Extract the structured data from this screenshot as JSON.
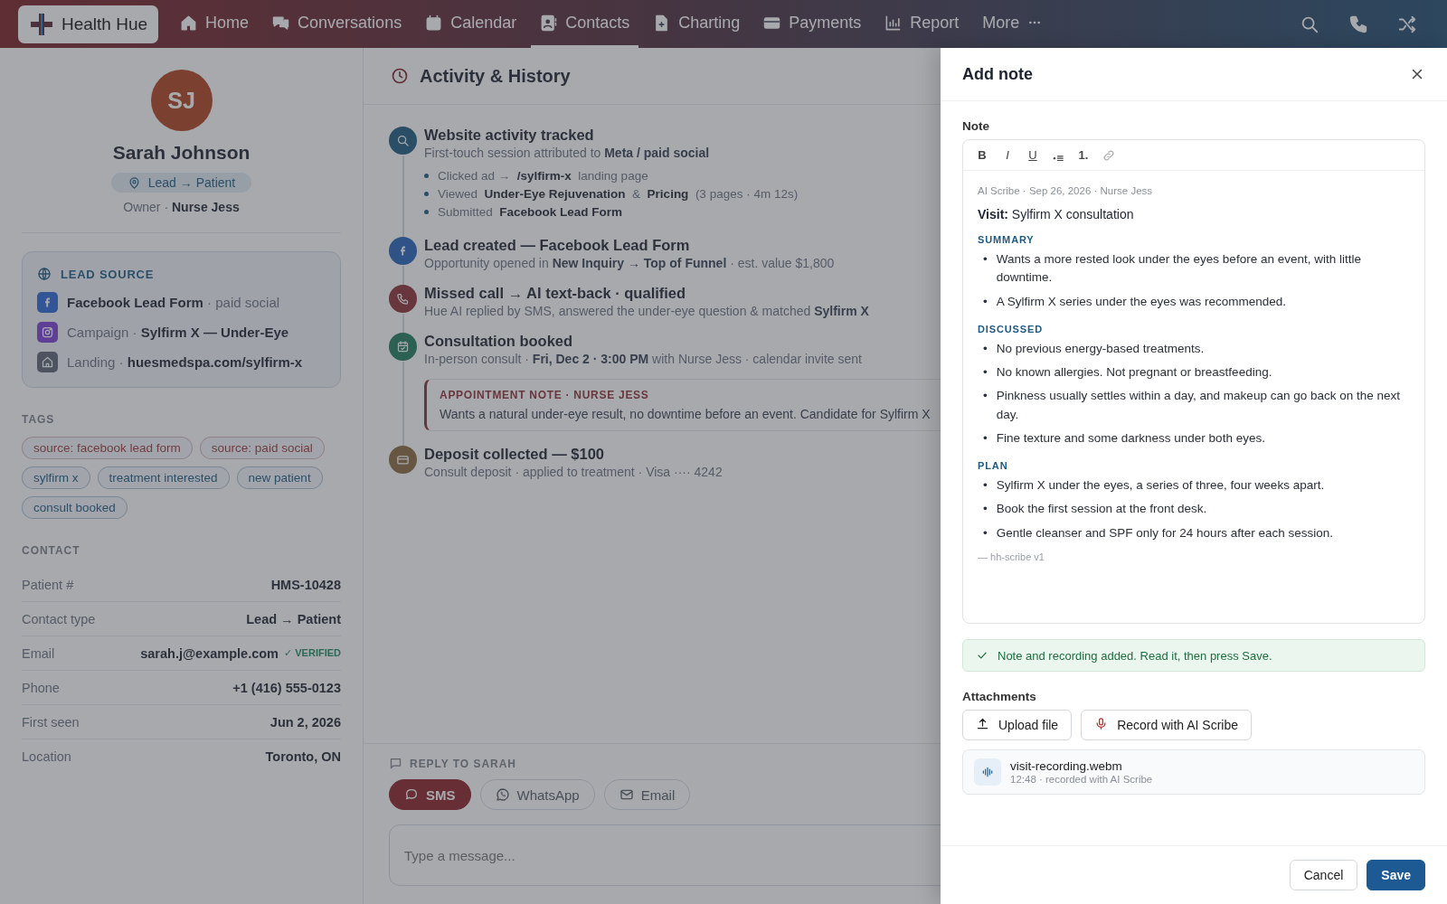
{
  "nav": {
    "brand": "Health Hue",
    "items": [
      {
        "kind": "home",
        "label": "Home",
        "selected": false
      },
      {
        "kind": "chat",
        "label": "Conversations",
        "selected": false
      },
      {
        "kind": "calendar",
        "label": "Calendar",
        "selected": false
      },
      {
        "kind": "contact",
        "label": "Contacts",
        "selected": true
      },
      {
        "kind": "chart",
        "label": "Charting",
        "selected": false
      },
      {
        "kind": "card",
        "label": "Payments",
        "selected": false
      },
      {
        "kind": "report",
        "label": "Report",
        "selected": false
      },
      {
        "kind": "more",
        "label": "More",
        "selected": false
      }
    ],
    "actions": [
      {
        "kind": "search"
      },
      {
        "kind": "phone"
      },
      {
        "kind": "shuffle"
      }
    ]
  },
  "profile": {
    "initials": "SJ",
    "name": "Sarah Johnson",
    "stage": "Lead → Patient",
    "owner": "Owner · **Nurse Jess**",
    "lead_source": {
      "title": "LEAD SOURCE",
      "rows": [
        {
          "kind": "facebook",
          "text": "**Facebook Lead Form** · paid social"
        },
        {
          "kind": "instagram",
          "text": "Campaign · **Sylfirm X — Under-Eye**"
        },
        {
          "kind": "landing",
          "text": "Landing · **huesmedspa.com/sylfirm-x**"
        }
      ]
    },
    "tags_title": "TAGS",
    "tags": [
      {
        "label": "source: facebook lead form",
        "kind": "source"
      },
      {
        "label": "source: paid social",
        "kind": "source"
      },
      {
        "label": "sylfirm x",
        "kind": "topic"
      },
      {
        "label": "treatment interested",
        "kind": "topic"
      },
      {
        "label": "new patient",
        "kind": "topic"
      },
      {
        "label": "consult booked",
        "kind": "topic"
      }
    ],
    "contact_title": "CONTACT",
    "contact": [
      {
        "label": "Patient #",
        "value": "HMS-10428"
      },
      {
        "label": "Contact type",
        "value": "Lead → Patient"
      },
      {
        "label": "Email",
        "value": "sarah.j@example.com",
        "verified": "✓ VERIFIED"
      },
      {
        "label": "Phone",
        "value": "+1 (416) 555-0123"
      },
      {
        "label": "First seen",
        "value": "Jun 2, 2026"
      },
      {
        "label": "Location",
        "value": "Toronto, ON"
      }
    ]
  },
  "activity": {
    "title": "Activity & History",
    "events": [
      {
        "kind": "search",
        "title": "Website activity tracked",
        "subtitle": "First-touch session attributed to **Meta / paid social**",
        "bullets": [
          "Clicked ad →  **/sylfirm-x**  landing page",
          "Viewed  **Under-Eye Rejuvenation**  &  **Pricing**  (3 pages · 4m 12s)",
          "Submitted  **Facebook Lead Form**"
        ]
      },
      {
        "kind": "facebook",
        "title": "Lead created — Facebook Lead Form",
        "subtitle": "Opportunity opened in **New Inquiry → Top of Funnel** · est. value $1,800"
      },
      {
        "kind": "phone",
        "title": "Missed call → AI text-back · qualified",
        "subtitle": "Hue AI replied by SMS, answered the under-eye question & matched **Sylfirm X**"
      },
      {
        "kind": "calendar",
        "title": "Consultation booked",
        "subtitle": "In-person consult · **Fri, Dec 2 · 3:00 PM** with Nurse Jess · calendar invite sent",
        "note": {
          "label": "APPOINTMENT NOTE · NURSE JESS",
          "text": "Wants a natural under-eye result, no downtime before an event. Candidate for Sylfirm X"
        }
      },
      {
        "kind": "card",
        "title": "Deposit collected — $100",
        "subtitle": "Consult deposit · applied to treatment · Visa ···· 4242"
      }
    ]
  },
  "reply": {
    "title": "REPLY TO SARAH",
    "channels": [
      {
        "kind": "sms",
        "label": "SMS",
        "selected": true
      },
      {
        "kind": "whatsapp",
        "label": "WhatsApp",
        "selected": false
      },
      {
        "kind": "email",
        "label": "Email",
        "selected": false
      }
    ],
    "placeholder": "Type a message..."
  },
  "drawer": {
    "title": "Add note",
    "field_label": "Note",
    "toolbar": [
      {
        "kind": "bold",
        "label": "B"
      },
      {
        "kind": "italic",
        "label": "I"
      },
      {
        "kind": "underline",
        "label": "U"
      },
      {
        "kind": "bullets"
      },
      {
        "kind": "numbered",
        "label": "1."
      },
      {
        "kind": "link"
      }
    ],
    "bullet": "•",
    "meta": "AI Scribe · Sep 26, 2026 · Nurse Jess",
    "visit": "**Visit:** Sylfirm X consultation",
    "sections": [
      {
        "heading": "SUMMARY",
        "items": [
          "Wants a more rested look under the eyes before an event, with little downtime.",
          "A Sylfirm X series under the eyes was recommended."
        ]
      },
      {
        "heading": "DISCUSSED",
        "items": [
          "No previous energy-based treatments.",
          "No known allergies. Not pregnant or breastfeeding.",
          "Pinkness usually settles within a day, and makeup can go back on the next day.",
          "Fine texture and some darkness under both eyes."
        ]
      },
      {
        "heading": "PLAN",
        "items": [
          "Sylfirm X under the eyes, a series of three, four weeks apart.",
          "Book the first session at the front desk.",
          "Gentle cleanser and SPF only for 24 hours after each session."
        ]
      }
    ],
    "signature": "— hh-scribe v1",
    "banner": "Note and recording added. Read it, then press Save.",
    "attachments_label": "Attachments",
    "attach_buttons": [
      {
        "kind": "upload",
        "label": "Upload file"
      },
      {
        "kind": "mic",
        "label": "Record with AI Scribe"
      }
    ],
    "file": {
      "name": "visit-recording.webm",
      "meta": "12:48 · recorded with AI Scribe"
    },
    "buttons": [
      {
        "kind": "secondary",
        "label": "Cancel"
      },
      {
        "kind": "primary",
        "label": "Save"
      }
    ]
  }
}
